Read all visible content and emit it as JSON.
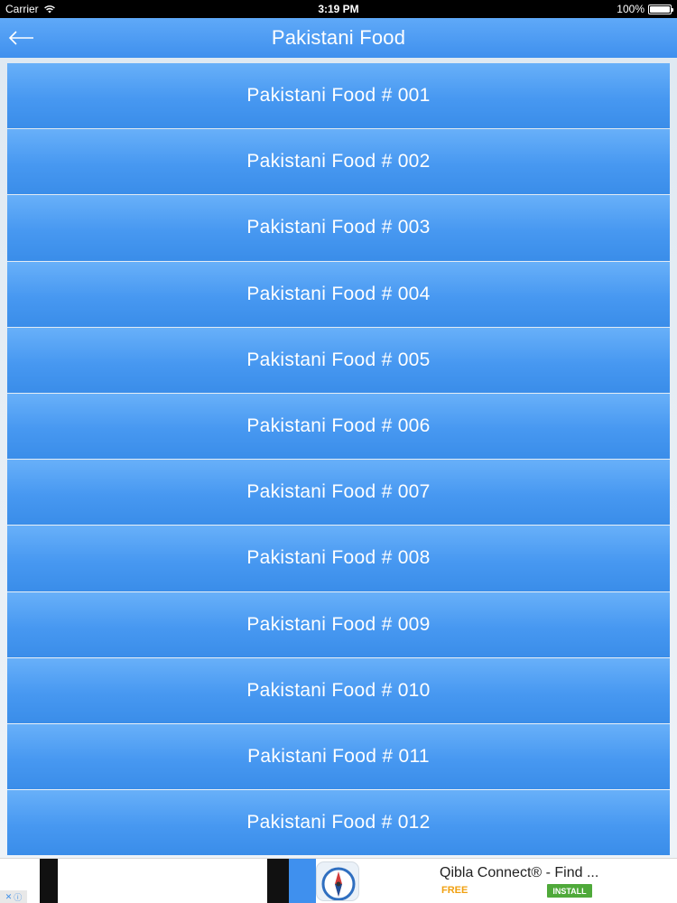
{
  "status_bar": {
    "carrier": "Carrier",
    "time": "3:19 PM",
    "battery": "100%",
    "battery_level": 1.0
  },
  "nav": {
    "title": "Pakistani Food",
    "back_icon": "arrow-left-icon"
  },
  "items": [
    {
      "label": "Pakistani Food # 001"
    },
    {
      "label": "Pakistani Food # 002"
    },
    {
      "label": "Pakistani Food # 003"
    },
    {
      "label": "Pakistani Food # 004"
    },
    {
      "label": "Pakistani Food # 005"
    },
    {
      "label": "Pakistani Food # 006"
    },
    {
      "label": "Pakistani Food # 007"
    },
    {
      "label": "Pakistani Food # 008"
    },
    {
      "label": "Pakistani Food # 009"
    },
    {
      "label": "Pakistani Food # 010"
    },
    {
      "label": "Pakistani Food # 011"
    },
    {
      "label": "Pakistani Food # 012"
    }
  ],
  "ad": {
    "app_name": "Qibla Connect® - Find ...",
    "price": "FREE",
    "install_label": "INSTALL",
    "icon": "compass-icon"
  },
  "colors": {
    "accent": "#3f90ee",
    "item_top": "#68b0f9",
    "item_bottom": "#3a8de9",
    "free": "#f0a010",
    "install": "#4fa93a"
  }
}
